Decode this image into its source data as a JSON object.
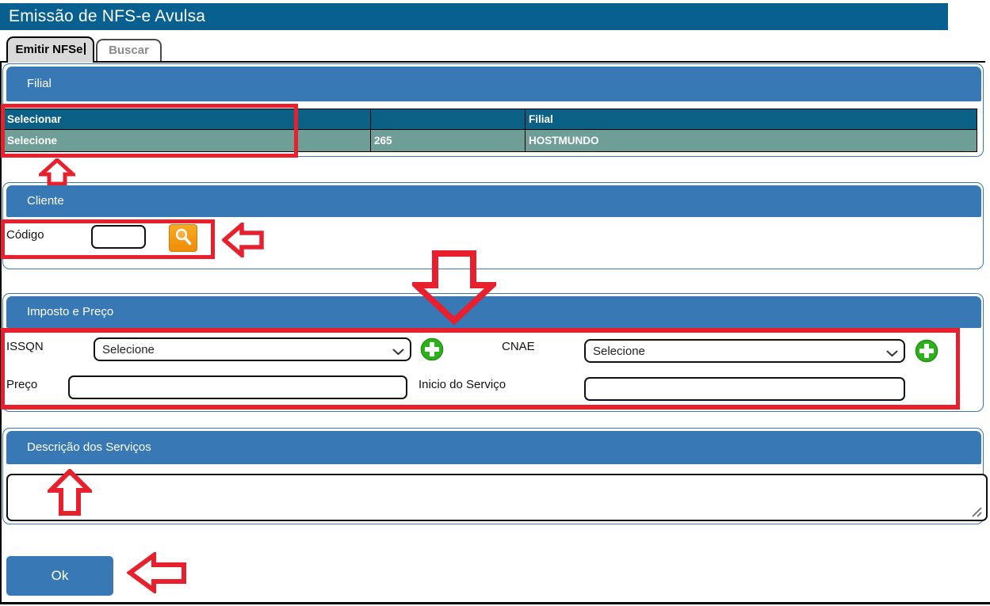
{
  "window": {
    "title": "Emissão de NFS-e Avulsa"
  },
  "tabs": {
    "emitir": "Emitir NFSe",
    "buscar": "Buscar"
  },
  "filial": {
    "header": "Filial",
    "columns": {
      "selecionar": "Selecionar",
      "middle": "",
      "filial": "Filial"
    },
    "row": {
      "select_link": "Selecione",
      "code": "265",
      "name": "HOSTMUNDO"
    }
  },
  "cliente": {
    "header": "Cliente",
    "codigo_label": "Código",
    "codigo_value": "",
    "search_icon": "magnifier-icon"
  },
  "imposto": {
    "header": "Imposto e Preço",
    "issqn_label": "ISSQN",
    "issqn_selected": "Selecione",
    "cnae_label": "CNAE",
    "cnae_selected": "Selecione",
    "preco_label": "Preço",
    "preco_value": "",
    "inicio_label": "Inicio do Serviço",
    "inicio_value": "",
    "add_icon": "plus-icon"
  },
  "descricao": {
    "header": "Descrição dos Serviços",
    "value": ""
  },
  "actions": {
    "ok": "Ok"
  },
  "colors": {
    "titlebar_blue": "#07608f",
    "section_header_blue": "#3878b4",
    "table_header_blue": "#0b6185",
    "table_row_teal": "#6f9e96",
    "search_orange": "#f29111",
    "plus_green": "#2eb01c",
    "annotation_red": "#e8202d",
    "ok_button_blue": "#3878b4"
  },
  "annotations": {
    "color": "#e8202d",
    "items": [
      "box-filial-selecionar",
      "arrow-up-filial",
      "box-cliente-codigo",
      "arrow-left-cliente",
      "arrow-down-imposto",
      "box-imposto-fields",
      "arrow-up-descricao",
      "arrow-left-ok"
    ]
  }
}
